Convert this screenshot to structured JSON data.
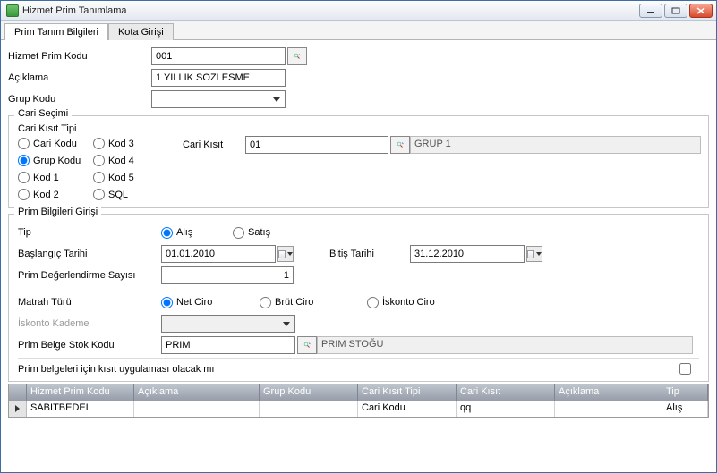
{
  "window": {
    "title": "Hizmet Prim Tanımlama",
    "min_icon": "minimize-icon",
    "max_icon": "maximize-icon",
    "close_icon": "close-icon"
  },
  "tabs": {
    "t0": "Prim Tanım Bilgileri",
    "t1": "Kota Girişi"
  },
  "labels": {
    "hizmet_prim_kodu": "Hizmet Prim Kodu",
    "aciklama": "Açıklama",
    "grup_kodu": "Grup Kodu",
    "cari_secimi": "Cari Seçimi",
    "cari_kisit_tipi": "Cari Kısıt Tipi",
    "cari_kisit": "Cari Kısıt",
    "prim_bilgileri_girisi": "Prim Bilgileri Girişi",
    "tip": "Tip",
    "baslangic_tarihi": "Başlangıç Tarihi",
    "bitis_tarihi": "Bitiş Tarihi",
    "prim_deg_sayisi": "Prim Değerlendirme Sayısı",
    "matrah_turu": "Matrah Türü",
    "iskonto_kademe": "İskonto Kademe",
    "prim_belge_stok_kodu": "Prim Belge Stok Kodu",
    "kisit_uygulamasi": "Prim belgeleri için kısıt uygulaması olacak mı"
  },
  "values": {
    "hizmet_prim_kodu": "001",
    "aciklama": "1 YILLIK SOZLESME",
    "grup_kodu": "",
    "cari_kisit": "01",
    "cari_kisit_desc": "GRUP 1",
    "baslangic_tarihi": "01.01.2010",
    "bitis_tarihi": "31.12.2010",
    "prim_deg_sayisi": "1",
    "prim_belge_stok_kodu": "PRIM",
    "prim_belge_stok_desc": "PRIM STOĞU"
  },
  "radios": {
    "cari_kodu": "Cari Kodu",
    "grup_kodu_r": "Grup Kodu",
    "kod1": "Kod 1",
    "kod2": "Kod 2",
    "kod3": "Kod 3",
    "kod4": "Kod 4",
    "kod5": "Kod 5",
    "sql": "SQL",
    "alis": "Alış",
    "satis": "Satış",
    "net_ciro": "Net Ciro",
    "brut_ciro": "Brüt Ciro",
    "iskonto_ciro": "İskonto Ciro"
  },
  "grid": {
    "headers": {
      "c0": "Hizmet Prim Kodu",
      "c1": "Açıklama",
      "c2": "Grup Kodu",
      "c3": "Cari Kısıt Tipi",
      "c4": "Cari Kısıt",
      "c5": "Açıklama",
      "c6": "Tip"
    },
    "rows": [
      {
        "c0": "SABITBEDEL",
        "c1": "",
        "c2": "",
        "c3": "Cari Kodu",
        "c4": "qq",
        "c5": "",
        "c6": "Alış"
      }
    ]
  }
}
